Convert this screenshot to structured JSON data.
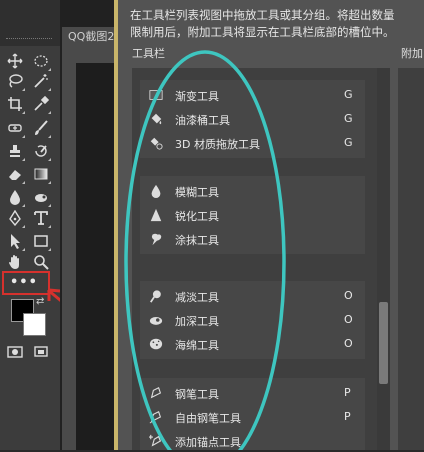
{
  "doc_tab": {
    "title": "QQ截图2"
  },
  "dialog": {
    "description": "在工具栏列表视图中拖放工具或其分组。将超出数量限制用后，附加工具将显示在工具栏底部的槽位中。",
    "toolbar_label": "工具栏",
    "extra_label": "附加"
  },
  "groups": [
    {
      "items": [
        {
          "name": "渐变工具",
          "key": "G",
          "icon": "gradient-icon"
        },
        {
          "name": "油漆桶工具",
          "key": "G",
          "icon": "paint-bucket-icon"
        },
        {
          "name": "3D 材质拖放工具",
          "key": "G",
          "icon": "material-drop-icon"
        }
      ]
    },
    {
      "items": [
        {
          "name": "模糊工具",
          "key": "",
          "icon": "blur-icon"
        },
        {
          "name": "锐化工具",
          "key": "",
          "icon": "sharpen-icon"
        },
        {
          "name": "涂抹工具",
          "key": "",
          "icon": "smudge-icon"
        }
      ]
    },
    {
      "items": [
        {
          "name": "减淡工具",
          "key": "O",
          "icon": "dodge-icon"
        },
        {
          "name": "加深工具",
          "key": "O",
          "icon": "burn-icon"
        },
        {
          "name": "海绵工具",
          "key": "O",
          "icon": "sponge-icon"
        }
      ]
    },
    {
      "items": [
        {
          "name": "钢笔工具",
          "key": "P",
          "icon": "pen-icon"
        },
        {
          "name": "自由钢笔工具",
          "key": "P",
          "icon": "freeform-pen-icon"
        },
        {
          "name": "添加锚点工具",
          "key": "",
          "icon": "add-anchor-icon"
        }
      ]
    }
  ],
  "toolbar": {
    "edit_toolbar_label": "•••",
    "foreground_color": "#000000",
    "background_color": "#ffffff"
  },
  "colors": {
    "highlight_box": "#d6312d",
    "annotation_ellipse": "#3ec6c0",
    "accent_line": "#c9b56a"
  }
}
